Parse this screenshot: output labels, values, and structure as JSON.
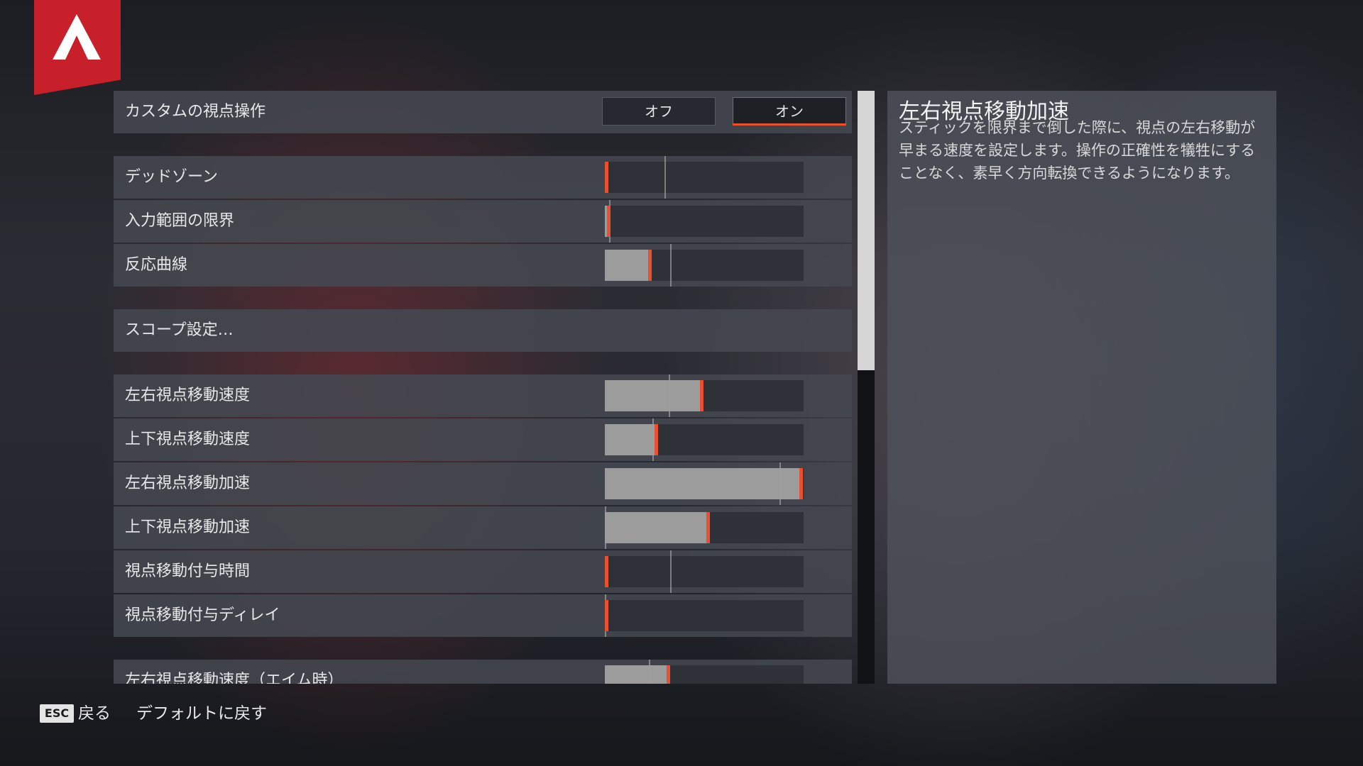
{
  "logo": {
    "color": "#c8202a",
    "icon": "apex-logo-icon"
  },
  "accent_color": "#e9502f",
  "custom_look": {
    "label": "カスタムの視点操作",
    "options": [
      "オフ",
      "オン"
    ],
    "selected": "オン"
  },
  "sliders_group1": [
    {
      "label": "デッドゾーン",
      "value": 0.01,
      "default": 0.3
    },
    {
      "label": "入力範囲の限界",
      "value": 0.02,
      "default": 0.02
    },
    {
      "label": "反応曲線",
      "value": 0.23,
      "default": 0.33
    }
  ],
  "scope_settings": {
    "label": "スコープ設定…"
  },
  "sliders_group2": [
    {
      "label": "左右視点移動速度",
      "value": 0.49,
      "default": 0.32
    },
    {
      "label": "上下視点移動速度",
      "value": 0.26,
      "default": 0.24
    },
    {
      "label": "左右視点移動加速",
      "value": 0.99,
      "default": 0.88
    },
    {
      "label": "上下視点移動加速",
      "value": 0.52,
      "default": 0.0
    },
    {
      "label": "視点移動付与時間",
      "value": 0.01,
      "default": 0.33
    },
    {
      "label": "視点移動付与ディレイ",
      "value": 0.01,
      "default": 0.0
    },
    {
      "label": "左右視点移動速度（エイム時）",
      "value": 0.32,
      "default": 0.22
    }
  ],
  "info_panel": {
    "title": "左右視点移動加速",
    "description": "スティックを限界まで倒した際に、視点の左右移動が早まる速度を設定します。操作の正確性を犠牲にすることなく、素早く方向転換できるようになります。"
  },
  "footer": {
    "esc_key": "ESC",
    "back_label": "戻る",
    "reset_label": "デフォルトに戻す"
  }
}
